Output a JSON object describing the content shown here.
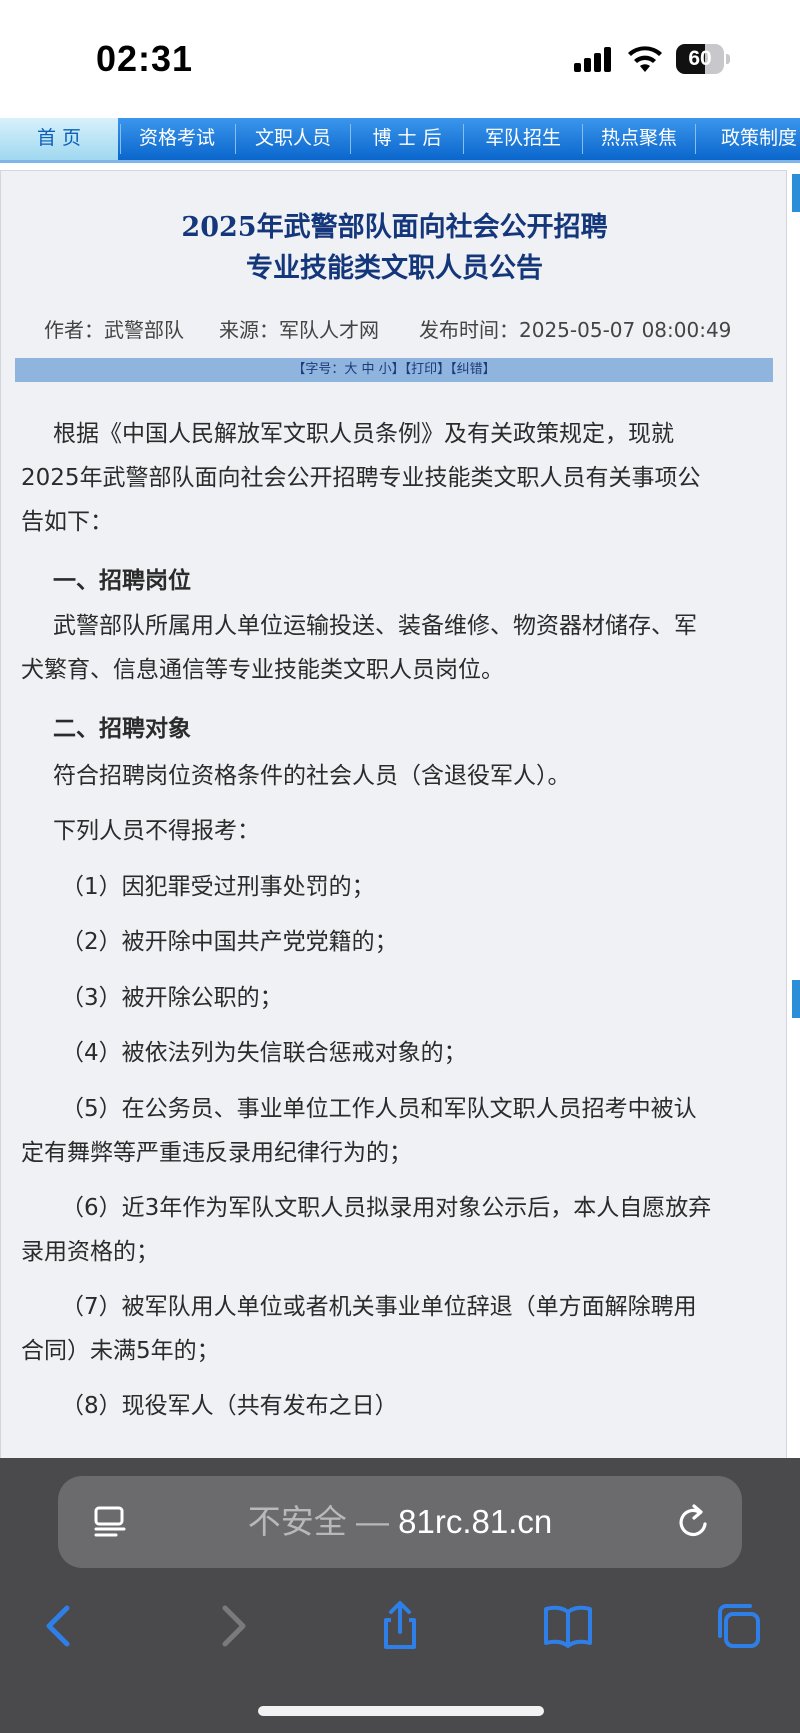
{
  "status_bar": {
    "time": "02:31",
    "battery": "60",
    "battery_level": 0.6
  },
  "nav": {
    "items": [
      {
        "label": "首 页",
        "active": true
      },
      {
        "label": "资格考试"
      },
      {
        "label": "文职人员"
      },
      {
        "label": "博 士 后"
      },
      {
        "label": "军队招生"
      },
      {
        "label": "热点聚焦"
      },
      {
        "label": "政策制度"
      }
    ]
  },
  "article": {
    "title_line1": "2025年武警部队面向社会公开招聘",
    "title_line2": "专业技能类文职人员公告",
    "author": "作者：武警部队",
    "source": "来源：军队人才网",
    "published": "发布时间：2025-05-07 08:00:49",
    "toolbar_text": "【字号：大 中 小】【打印】【纠错】",
    "intro_line1": "根据《中国人民解放军文职人员条例》及有关政策规定，现就",
    "intro_line2": "2025年武警部队面向社会公开招聘专业技能类文职人员有关事项公",
    "intro_line3": "告如下：",
    "section1_heading": "一、招聘岗位",
    "section1_line1": "武警部队所属用人单位运输投送、装备维修、物资器材储存、军",
    "section1_line2": "犬繁育、信息通信等专业技能类文职人员岗位。",
    "section2_heading": "二、招聘对象",
    "section2_p1": "符合招聘岗位资格条件的社会人员（含退役军人）。",
    "section2_p2": "下列人员不得报考：",
    "items": [
      "（1）因犯罪受过刑事处罚的；",
      "（2）被开除中国共产党党籍的；",
      "（3）被开除公职的；",
      "（4）被依法列为失信联合惩戒对象的；"
    ],
    "item5_line1": "（5）在公务员、事业单位工作人员和军队文职人员招考中被认",
    "item5_line2": "定有舞弊等严重违反录用纪律行为的；",
    "item6_line1": "（6）近3年作为军队文职人员拟录用对象公示后，本人自愿放弃",
    "item6_line2": "录用资格的；",
    "item7_line1": "（7）被军队用人单位或者机关事业单位辞退（单方面解除聘用",
    "item7_line2": "合同）未满5年的；",
    "item8_partial": "（8）现役军人（共有发布之日）"
  },
  "safari": {
    "address_insecure": "不安全 —",
    "address_domain": "81rc.81.cn"
  },
  "colors": {
    "nav_blue": "#0a66cc",
    "title_navy": "#14367a",
    "safari_blue": "#2f7fe8"
  }
}
